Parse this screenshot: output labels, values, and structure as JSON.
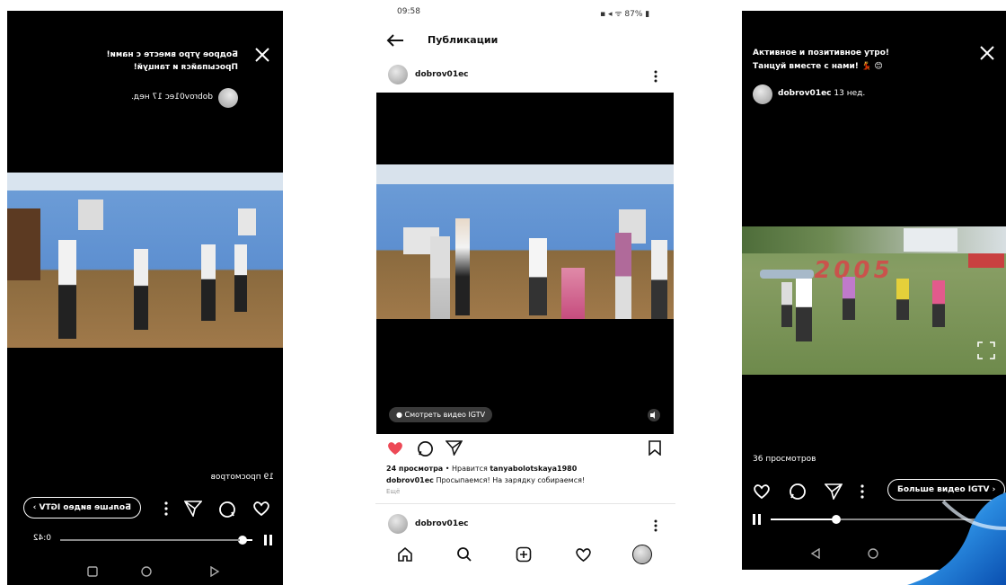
{
  "left_screen": {
    "caption_line1": "Бодрое утро вместе с нами!",
    "caption_line2": "Просыпайся и танцуй!",
    "author": "dobrov01ec",
    "age": "17 нед.",
    "views": "19 просмотров",
    "more_igtv": "Больше видео IGTV",
    "time": "0:42"
  },
  "middle_screen": {
    "status_time": "09:58",
    "status_right": "87%",
    "title": "Публикации",
    "author": "dobrov01ec",
    "watch_igtv": "Смотреть видео IGTV",
    "views_line_count": "24 просмотра",
    "likes_prefix": "• Нравится",
    "liked_by": "tanyabolotskaya1980",
    "caption_author": "dobrov01ec",
    "caption_text": "Просыпаемся! На зарядку собираемся!",
    "more": "Ещё",
    "next_author": "dobrov01ec"
  },
  "right_screen": {
    "caption_line1": "Активное и позитивное утро!",
    "caption_line2": "Танцуй вместе с нами! 💃 😊",
    "author": "dobrov01ec",
    "age": "13 нед.",
    "views": "36 просмотров",
    "more_igtv": "Больше видео IGTV",
    "sign_text": "2005"
  },
  "icons": {
    "close": "close-icon",
    "heart": "heart-icon",
    "comment": "comment-icon",
    "share": "send-icon",
    "more": "more-vertical-icon",
    "play": "play-icon",
    "pause": "pause-icon",
    "bookmark": "bookmark-icon",
    "home": "home-icon",
    "search": "search-icon",
    "add": "add-icon",
    "back": "back-arrow-icon",
    "expand": "fullscreen-icon",
    "mute": "mute-icon"
  },
  "colors": {
    "like_red": "#ed4956",
    "link_blue": "#385185"
  }
}
